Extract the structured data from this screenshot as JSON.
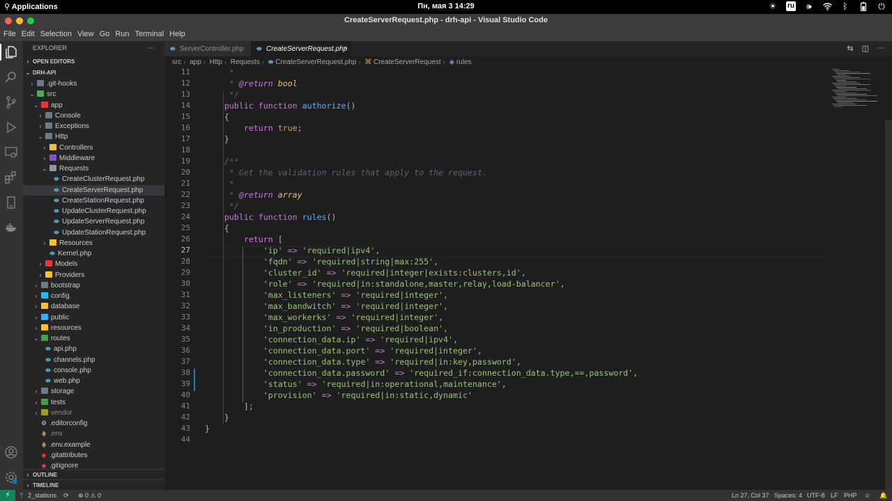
{
  "topbar": {
    "apps_label": "Applications",
    "clock": "Пн, мая  3   14:29",
    "lang": "ru"
  },
  "window": {
    "title": "CreateServerRequest.php - drh-api - Visual Studio Code"
  },
  "menu": [
    "File",
    "Edit",
    "Selection",
    "View",
    "Go",
    "Run",
    "Terminal",
    "Help"
  ],
  "sidebar": {
    "title": "EXPLORER",
    "more": "···",
    "open_editors": "OPEN EDITORS",
    "project": "DRH-API",
    "tree": [
      {
        "label": ".git-hooks",
        "depth": 1,
        "type": "folder",
        "chev": "›",
        "color": "#6b7b8a"
      },
      {
        "label": "src",
        "depth": 1,
        "type": "folder",
        "chev": "⌄",
        "color": "#4caf50"
      },
      {
        "label": "app",
        "depth": 2,
        "type": "folder",
        "chev": "⌄",
        "color": "#e53935"
      },
      {
        "label": "Console",
        "depth": 3,
        "type": "folder",
        "chev": "›",
        "color": "#6b7b8a"
      },
      {
        "label": "Exceptions",
        "depth": 3,
        "type": "folder",
        "chev": "›",
        "color": "#6b7b8a"
      },
      {
        "label": "Http",
        "depth": 3,
        "type": "folder",
        "chev": "⌄",
        "color": "#6b7b8a"
      },
      {
        "label": "Controllers",
        "depth": 4,
        "type": "folder",
        "chev": "›",
        "color": "#fbc02d"
      },
      {
        "label": "Middleware",
        "depth": 4,
        "type": "folder",
        "chev": "›",
        "color": "#7e57c2"
      },
      {
        "label": "Requests",
        "depth": 4,
        "type": "folder",
        "chev": "⌄",
        "color": "#8a9aa8"
      },
      {
        "label": "CreateClusterRequest.php",
        "depth": 5,
        "type": "php"
      },
      {
        "label": "CreateServerRequest.php",
        "depth": 5,
        "type": "php",
        "selected": true
      },
      {
        "label": "CreateStationRequest.php",
        "depth": 5,
        "type": "php"
      },
      {
        "label": "UpdateClusterRequest.php",
        "depth": 5,
        "type": "php"
      },
      {
        "label": "UpdateServerRequest.php",
        "depth": 5,
        "type": "php"
      },
      {
        "label": "UpdateStationRequest.php",
        "depth": 5,
        "type": "php"
      },
      {
        "label": "Resources",
        "depth": 4,
        "type": "folder",
        "chev": "›",
        "color": "#fbc02d"
      },
      {
        "label": "Kernel.php",
        "depth": 4,
        "type": "php"
      },
      {
        "label": "Models",
        "depth": 3,
        "type": "folder",
        "chev": "›",
        "color": "#e53935"
      },
      {
        "label": "Providers",
        "depth": 3,
        "type": "folder",
        "chev": "›",
        "color": "#fbc02d"
      },
      {
        "label": "bootstrap",
        "depth": 2,
        "type": "folder",
        "chev": "›",
        "color": "#6b7b8a"
      },
      {
        "label": "config",
        "depth": 2,
        "type": "folder",
        "chev": "›",
        "color": "#29b6f6"
      },
      {
        "label": "database",
        "depth": 2,
        "type": "folder",
        "chev": "›",
        "color": "#fbc02d"
      },
      {
        "label": "public",
        "depth": 2,
        "type": "folder",
        "chev": "›",
        "color": "#29b6f6"
      },
      {
        "label": "resources",
        "depth": 2,
        "type": "folder",
        "chev": "›",
        "color": "#fbc02d"
      },
      {
        "label": "routes",
        "depth": 2,
        "type": "folder",
        "chev": "⌄",
        "color": "#43a047"
      },
      {
        "label": "api.php",
        "depth": 3,
        "type": "php"
      },
      {
        "label": "channels.php",
        "depth": 3,
        "type": "php"
      },
      {
        "label": "console.php",
        "depth": 3,
        "type": "php"
      },
      {
        "label": "web.php",
        "depth": 3,
        "type": "php"
      },
      {
        "label": "storage",
        "depth": 2,
        "type": "folder",
        "chev": "›",
        "color": "#6b7b8a"
      },
      {
        "label": "tests",
        "depth": 2,
        "type": "folder",
        "chev": "›",
        "color": "#43a047"
      },
      {
        "label": "vendor",
        "depth": 2,
        "type": "folder",
        "chev": "›",
        "color": "#9e9d24",
        "dim": true
      },
      {
        "label": ".editorconfig",
        "depth": 2,
        "type": "gear"
      },
      {
        "label": ".env",
        "depth": 2,
        "type": "env",
        "dim": true
      },
      {
        "label": ".env.example",
        "depth": 2,
        "type": "env"
      },
      {
        "label": ".gitattributes",
        "depth": 2,
        "type": "git"
      },
      {
        "label": ".gitignore",
        "depth": 2,
        "type": "git"
      }
    ],
    "outline": "OUTLINE",
    "timeline": "TIMELINE"
  },
  "tabs": [
    {
      "label": "ServerController.php",
      "active": false
    },
    {
      "label": "CreateServerRequest.php",
      "active": true,
      "close": "×"
    }
  ],
  "breadcrumb": [
    "src",
    "app",
    "Http",
    "Requests",
    "CreateServerRequest.php",
    "CreateServerRequest",
    "rules"
  ],
  "editor": {
    "first_line": 11,
    "current_line": 27,
    "lines": [
      [
        [
          "cmg",
          "     *"
        ]
      ],
      [
        [
          "cmg",
          "     * "
        ],
        [
          "tag",
          "@return"
        ],
        [
          "cmg",
          " "
        ],
        [
          "typ",
          "bool"
        ]
      ],
      [
        [
          "cmg",
          "     */"
        ]
      ],
      [
        [
          "kw",
          "    public function "
        ],
        [
          "fn",
          "authorize"
        ],
        [
          "pl",
          "()"
        ]
      ],
      [
        [
          "pl",
          "    {"
        ]
      ],
      [
        [
          "kw",
          "        return "
        ],
        [
          "cn",
          "true"
        ],
        [
          "pl",
          ";"
        ]
      ],
      [
        [
          "pl",
          "    }"
        ]
      ],
      [
        [
          "pl",
          ""
        ]
      ],
      [
        [
          "cmg",
          "    /**"
        ]
      ],
      [
        [
          "cmg",
          "     * Get the validation rules that apply to the request."
        ]
      ],
      [
        [
          "cmg",
          "     *"
        ]
      ],
      [
        [
          "cmg",
          "     * "
        ],
        [
          "tag",
          "@return"
        ],
        [
          "cmg",
          " "
        ],
        [
          "typ",
          "array"
        ]
      ],
      [
        [
          "cmg",
          "     */"
        ]
      ],
      [
        [
          "kw",
          "    public function "
        ],
        [
          "fn",
          "rules"
        ],
        [
          "pl",
          "()"
        ]
      ],
      [
        [
          "pl",
          "    {"
        ]
      ],
      [
        [
          "kw",
          "        return "
        ],
        [
          "pl",
          "["
        ]
      ],
      [
        [
          "pl",
          "            "
        ],
        [
          "s2",
          "'ip'"
        ],
        [
          "op",
          " => "
        ],
        [
          "s2",
          "'required|ipv4'"
        ],
        [
          "pl",
          ","
        ]
      ],
      [
        [
          "pl",
          "            "
        ],
        [
          "s2",
          "'fqdn'"
        ],
        [
          "op",
          " => "
        ],
        [
          "s2",
          "'required|string|max:255'"
        ],
        [
          "pl",
          ","
        ]
      ],
      [
        [
          "pl",
          "            "
        ],
        [
          "s2",
          "'cluster_id'"
        ],
        [
          "op",
          " => "
        ],
        [
          "s2",
          "'required|integer|exists:clusters,id'"
        ],
        [
          "pl",
          ","
        ]
      ],
      [
        [
          "pl",
          "            "
        ],
        [
          "s2",
          "'role'"
        ],
        [
          "op",
          " => "
        ],
        [
          "s2",
          "'required|in:standalone,master,relay,load-balancer'"
        ],
        [
          "pl",
          ","
        ]
      ],
      [
        [
          "pl",
          "            "
        ],
        [
          "s2",
          "'max_listeners'"
        ],
        [
          "op",
          " => "
        ],
        [
          "s2",
          "'required|integer'"
        ],
        [
          "pl",
          ","
        ]
      ],
      [
        [
          "pl",
          "            "
        ],
        [
          "s2",
          "'max_bandwitch'"
        ],
        [
          "op",
          " => "
        ],
        [
          "s2",
          "'required|integer'"
        ],
        [
          "pl",
          ","
        ]
      ],
      [
        [
          "pl",
          "            "
        ],
        [
          "s2",
          "'max_workerks'"
        ],
        [
          "op",
          " => "
        ],
        [
          "s2",
          "'required|integer'"
        ],
        [
          "pl",
          ","
        ]
      ],
      [
        [
          "pl",
          "            "
        ],
        [
          "s2",
          "'in_production'"
        ],
        [
          "op",
          " => "
        ],
        [
          "s2",
          "'required|boolean'"
        ],
        [
          "pl",
          ","
        ]
      ],
      [
        [
          "pl",
          "            "
        ],
        [
          "s2",
          "'connection_data.ip'"
        ],
        [
          "op",
          " => "
        ],
        [
          "s2",
          "'required|ipv4'"
        ],
        [
          "pl",
          ","
        ]
      ],
      [
        [
          "pl",
          "            "
        ],
        [
          "s2",
          "'connection_data.port'"
        ],
        [
          "op",
          " => "
        ],
        [
          "s2",
          "'required|integer'"
        ],
        [
          "pl",
          ","
        ]
      ],
      [
        [
          "pl",
          "            "
        ],
        [
          "s2",
          "'connection_data.type'"
        ],
        [
          "op",
          " => "
        ],
        [
          "s2",
          "'required|in:key,password'"
        ],
        [
          "pl",
          ","
        ]
      ],
      [
        [
          "pl",
          "            "
        ],
        [
          "s2",
          "'connection_data.password'"
        ],
        [
          "op",
          " => "
        ],
        [
          "s2",
          "'required_if:connection_data.type,==,password'"
        ],
        [
          "pl",
          ","
        ]
      ],
      [
        [
          "pl",
          "            "
        ],
        [
          "s2",
          "'status'"
        ],
        [
          "op",
          " => "
        ],
        [
          "s2",
          "'required|in:operational,maintenance'"
        ],
        [
          "pl",
          ","
        ]
      ],
      [
        [
          "pl",
          "            "
        ],
        [
          "s2",
          "'provision'"
        ],
        [
          "op",
          " => "
        ],
        [
          "s2",
          "'required|in:static,dynamic'"
        ]
      ],
      [
        [
          "pl",
          "        ];"
        ]
      ],
      [
        [
          "pl",
          "    }"
        ]
      ],
      [
        [
          "pl",
          "}"
        ]
      ],
      [
        [
          "pl",
          ""
        ]
      ]
    ]
  },
  "status": {
    "branch": "2_stations",
    "problems": "⊗ 0 ⚠ 0",
    "position": "Ln 27, Col 37",
    "spaces": "Spaces: 4",
    "encoding": "UTF-8",
    "eol": "LF",
    "language": "PHP"
  },
  "colors": {
    "statusbar": "#333333",
    "accent": "#007acc",
    "remote": "#16825d"
  }
}
